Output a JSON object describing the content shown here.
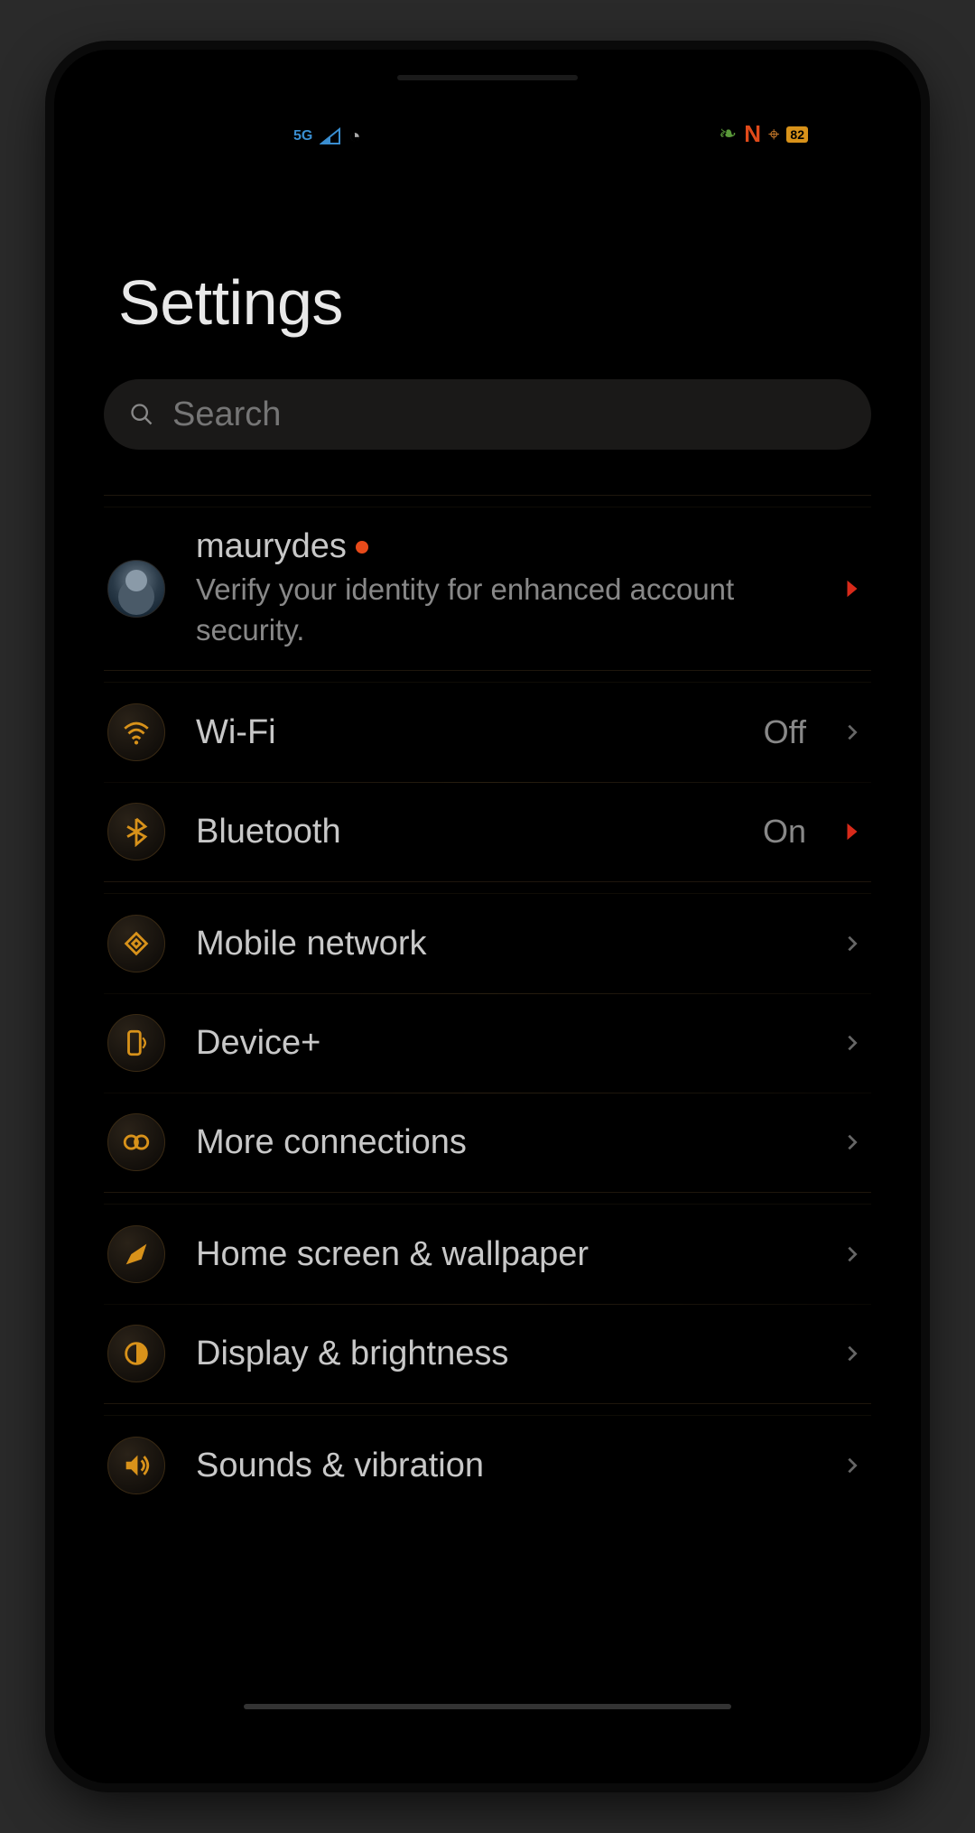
{
  "status_bar": {
    "network_type": "5G",
    "battery_level": "82"
  },
  "page": {
    "title": "Settings"
  },
  "search": {
    "placeholder": "Search"
  },
  "account": {
    "username": "maurydes",
    "subtitle": "Verify your identity for enhanced account security.",
    "has_alert": true
  },
  "items": [
    {
      "icon": "wifi",
      "label": "Wi-Fi",
      "value": "Off",
      "chevron": "gray"
    },
    {
      "icon": "bluetooth",
      "label": "Bluetooth",
      "value": "On",
      "chevron": "red"
    },
    {
      "icon": "sim",
      "label": "Mobile network",
      "value": "",
      "chevron": "gray"
    },
    {
      "icon": "device",
      "label": "Device+",
      "value": "",
      "chevron": "gray"
    },
    {
      "icon": "link",
      "label": "More connections",
      "value": "",
      "chevron": "gray"
    },
    {
      "icon": "brush",
      "label": "Home screen & wallpaper",
      "value": "",
      "chevron": "gray"
    },
    {
      "icon": "brightness",
      "label": "Display & brightness",
      "value": "",
      "chevron": "gray"
    },
    {
      "icon": "sound",
      "label": "Sounds & vibration",
      "value": "",
      "chevron": "gray"
    }
  ],
  "colors": {
    "accent": "#d8921a",
    "alert": "#e84a1a"
  }
}
